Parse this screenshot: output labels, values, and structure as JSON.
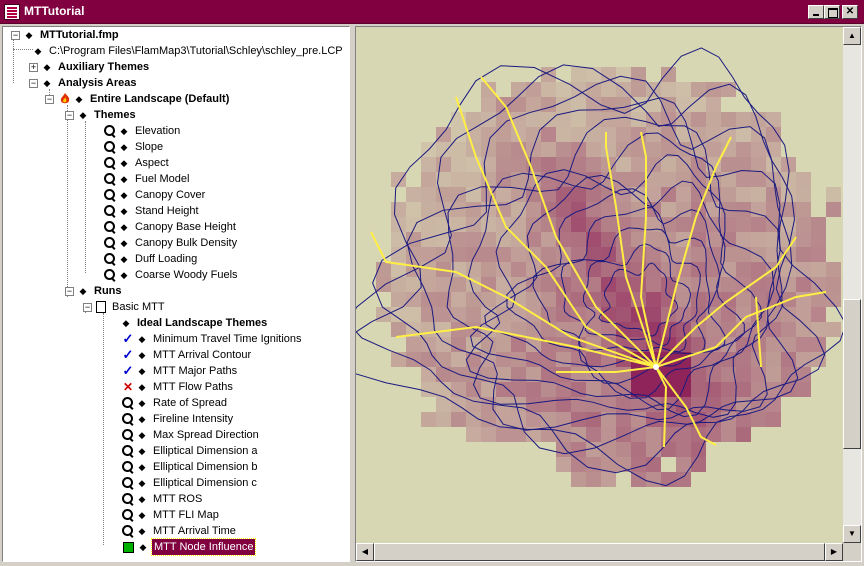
{
  "window": {
    "title": "MTTutorial"
  },
  "tree": {
    "project": "MTTutorial.fmp",
    "landscape_file": "C:\\Program Files\\FlamMap3\\Tutorial\\Schley\\schley_pre.LCP",
    "auxiliary_themes": "Auxiliary Themes",
    "analysis_areas": "Analysis Areas",
    "entire_landscape": "Entire Landscape (Default)",
    "themes_label": "Themes",
    "themes": [
      "Elevation",
      "Slope",
      "Aspect",
      "Fuel Model",
      "Canopy Cover",
      "Stand Height",
      "Canopy Base Height",
      "Canopy Bulk Density",
      "Duff Loading",
      "Coarse Woody Fuels"
    ],
    "runs_label": "Runs",
    "run_name": "Basic MTT",
    "ideal_themes": "Ideal Landscape Themes",
    "outputs": [
      {
        "label": "Minimum Travel Time Ignitions",
        "icon": "check-icon"
      },
      {
        "label": "MTT Arrival Contour",
        "icon": "check-icon"
      },
      {
        "label": "MTT Major Paths",
        "icon": "check-icon"
      },
      {
        "label": "MTT Flow Paths",
        "icon": "x-icon"
      },
      {
        "label": "Rate of Spread",
        "icon": "magnifier-icon"
      },
      {
        "label": "Fireline Intensity",
        "icon": "magnifier-icon"
      },
      {
        "label": "Max Spread Direction",
        "icon": "magnifier-icon"
      },
      {
        "label": "Elliptical Dimension a",
        "icon": "magnifier-icon"
      },
      {
        "label": "Elliptical Dimension b",
        "icon": "magnifier-icon"
      },
      {
        "label": "Elliptical Dimension c",
        "icon": "magnifier-icon"
      },
      {
        "label": "MTT ROS",
        "icon": "magnifier-icon"
      },
      {
        "label": "MTT FLI Map",
        "icon": "magnifier-icon"
      },
      {
        "label": "MTT Arrival Time",
        "icon": "magnifier-icon"
      },
      {
        "label": "MTT Node Influence",
        "icon": "green-square-icon"
      }
    ],
    "selected": "MTT Node Influence"
  },
  "map": {
    "background_color": "#d8d7b4",
    "cell_color": "#8a1a55",
    "contour_color": "#1a1a80",
    "path_color": "#ffee44"
  }
}
